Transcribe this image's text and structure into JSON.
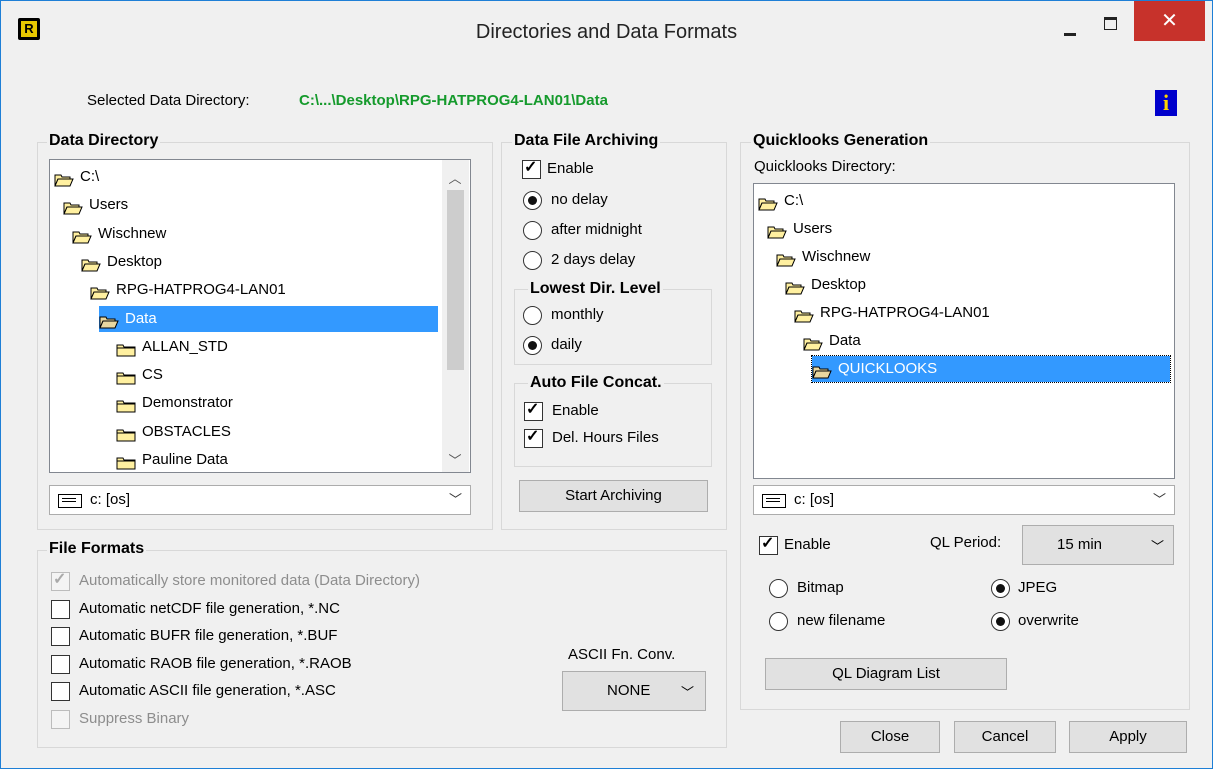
{
  "window": {
    "title": "Directories and Data Formats",
    "app_icon_letter": "R",
    "close_glyph": "✕"
  },
  "header": {
    "selected_label": "Selected Data Directory:",
    "selected_path": "C:\\...\\Desktop\\RPG-HATPROG4-LAN01\\Data",
    "info_glyph": "i"
  },
  "data_directory": {
    "title": "Data Directory",
    "tree": [
      "C:\\",
      "Users",
      "Wischnew",
      "Desktop",
      "RPG-HATPROG4-LAN01",
      "Data",
      "ALLAN_STD",
      "CS",
      "Demonstrator",
      "OBSTACLES",
      "Pauline Data"
    ],
    "selected": "Data",
    "drive": "c: [os]"
  },
  "archiving": {
    "title": "Data File Archiving",
    "enable_label": "Enable",
    "enable_checked": true,
    "delay_options": [
      "no delay",
      "after midnight",
      "2 days delay"
    ],
    "delay_selected": "no delay",
    "lowest_title": "Lowest Dir. Level",
    "level_options": [
      "monthly",
      "daily"
    ],
    "level_selected": "daily",
    "concat_title": "Auto File Concat.",
    "concat_enable_label": "Enable",
    "concat_del_label": "Del. Hours Files",
    "start_button": "Start Archiving"
  },
  "quicklooks": {
    "title": "Quicklooks Generation",
    "dir_label": "Quicklooks Directory:",
    "tree": [
      "C:\\",
      "Users",
      "Wischnew",
      "Desktop",
      "RPG-HATPROG4-LAN01",
      "Data",
      "QUICKLOOKS"
    ],
    "selected": "QUICKLOOKS",
    "drive": "c: [os]",
    "enable_label": "Enable",
    "period_label": "QL Period:",
    "period_value": "15 min",
    "format_options": [
      "Bitmap",
      "JPEG"
    ],
    "format_selected": "JPEG",
    "file_options": [
      "new filename",
      "overwrite"
    ],
    "file_selected": "overwrite",
    "diagram_button": "QL Diagram List"
  },
  "file_formats": {
    "title": "File Formats",
    "items": [
      {
        "label": "Automatically store monitored data (Data Directory)",
        "checked": true,
        "disabled": true
      },
      {
        "label": "Automatic netCDF file generation, *.NC",
        "checked": false,
        "disabled": false
      },
      {
        "label": "Automatic BUFR file generation, *.BUF",
        "checked": false,
        "disabled": false
      },
      {
        "label": "Automatic RAOB file generation, *.RAOB",
        "checked": false,
        "disabled": false
      },
      {
        "label": "Automatic ASCII file generation, *.ASC",
        "checked": false,
        "disabled": false
      },
      {
        "label": "Suppress Binary",
        "checked": false,
        "disabled": true
      }
    ],
    "ascii_label": "ASCII Fn. Conv.",
    "ascii_value": "NONE"
  },
  "footer": {
    "close": "Close",
    "cancel": "Cancel",
    "apply": "Apply"
  }
}
